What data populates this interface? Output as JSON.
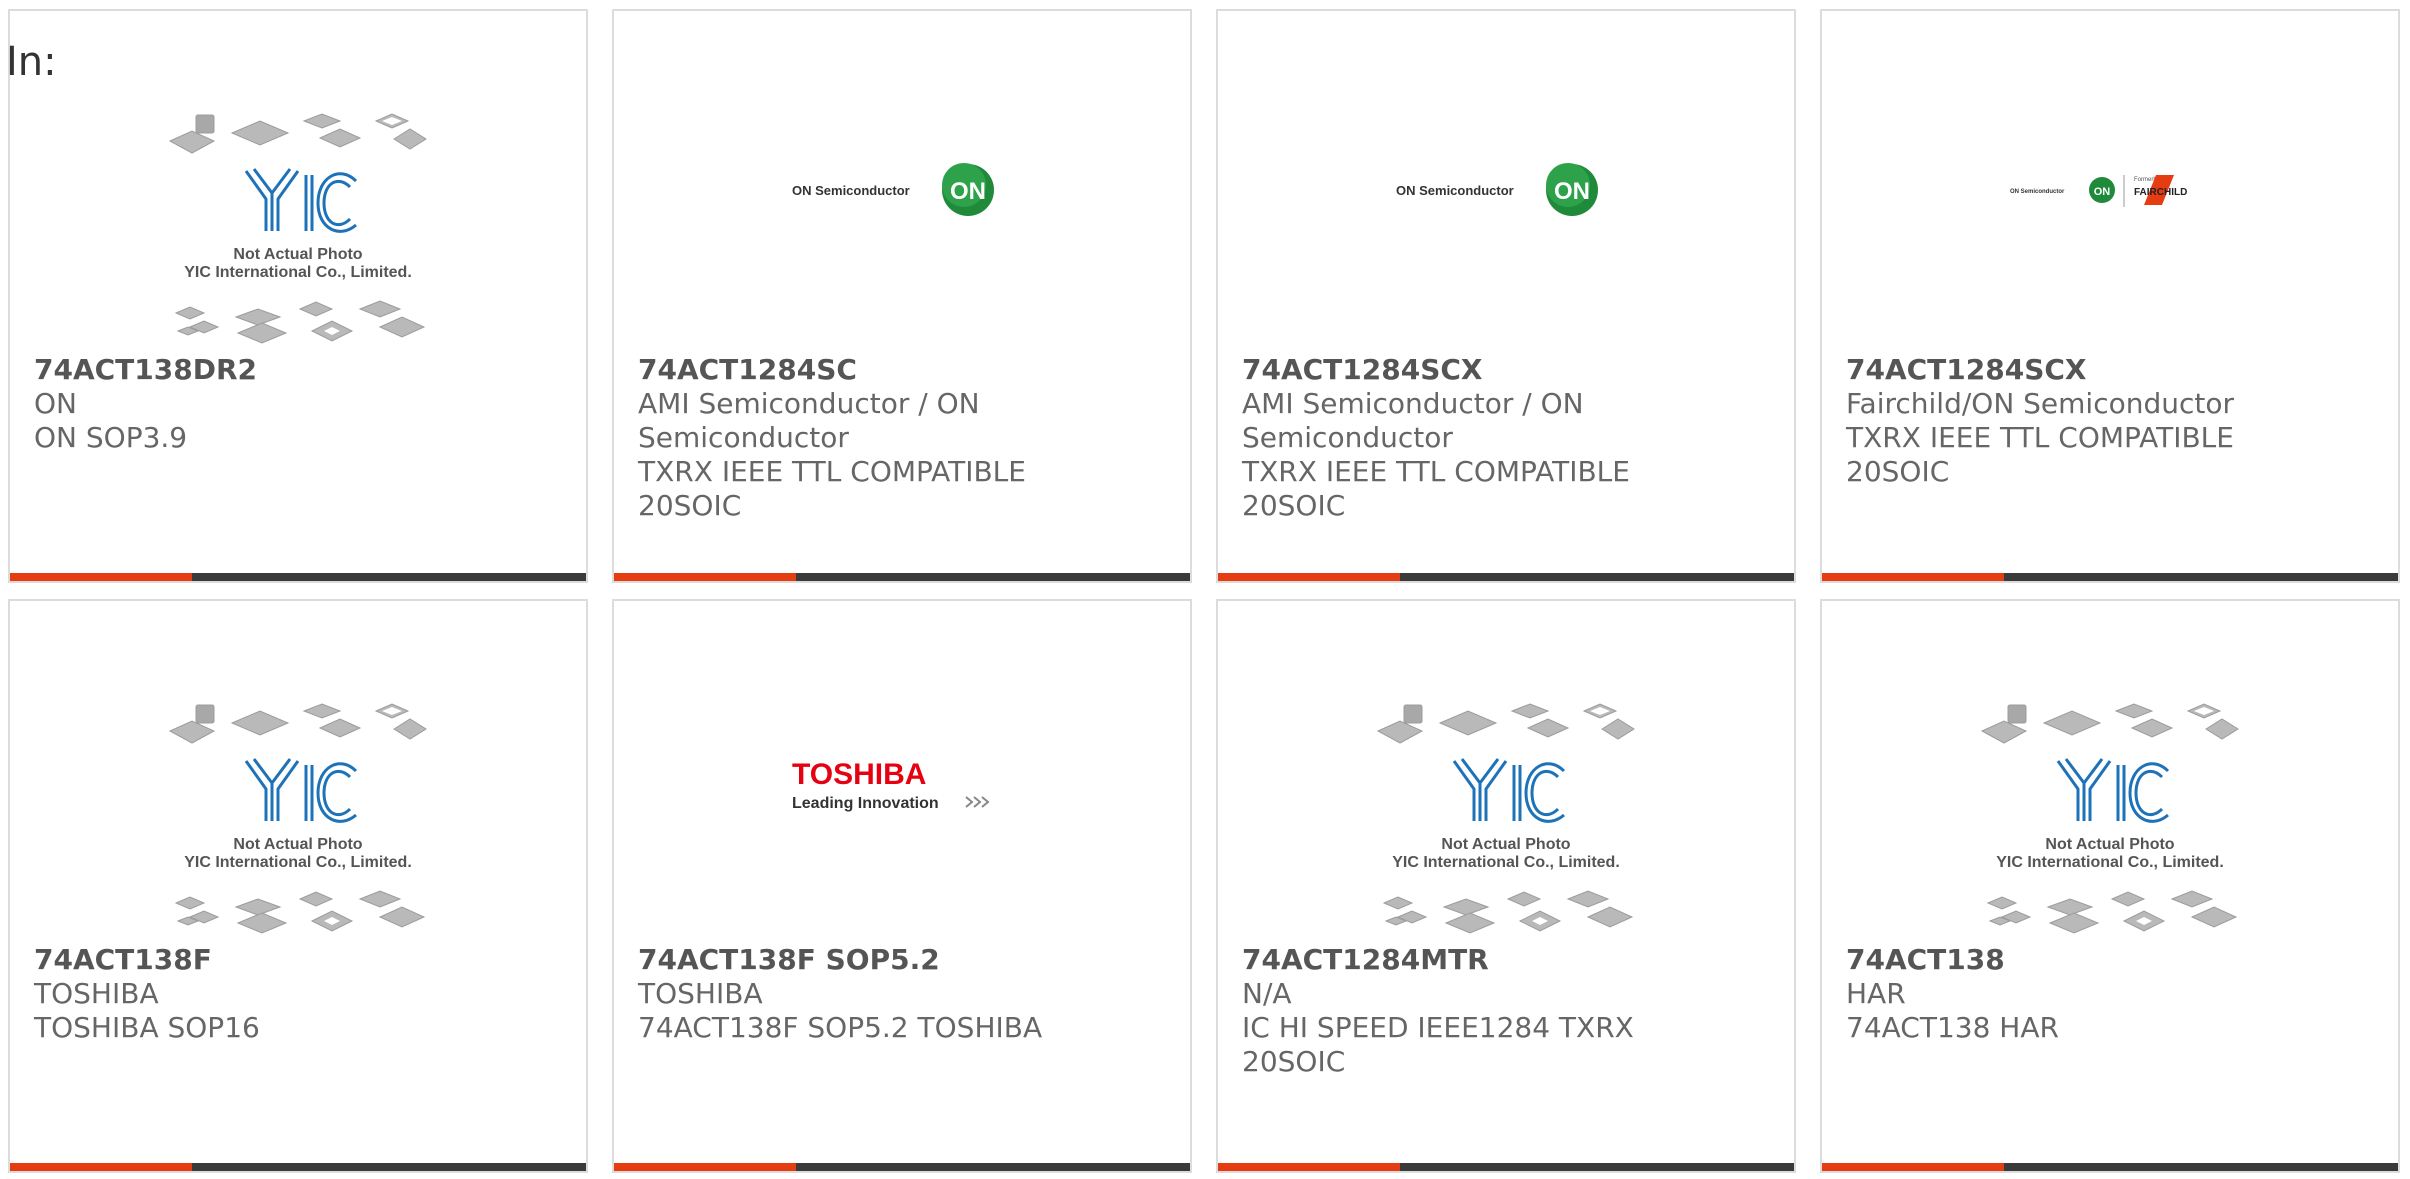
{
  "header": {
    "in_label": "In:"
  },
  "placeholder": {
    "line1": "Not Actual Photo",
    "line2": "YIC International Co., Limited."
  },
  "logos": {
    "on_text": "ON Semiconductor",
    "on_badge": "ON",
    "fairchild_formerly": "Formerly",
    "fairchild_name": "FAIRCHILD",
    "toshiba_name": "TOSHIBA",
    "toshiba_tagline": "Leading Innovation"
  },
  "colors": {
    "accent": "#e63c12",
    "bar_dark": "#3a3a3a",
    "on_green": "#1f8a3a",
    "toshiba_red": "#e60012",
    "yic_blue": "#1d72b8"
  },
  "products": [
    {
      "part": "74ACT138DR2",
      "lines": [
        "ON",
        "ON SOP3.9"
      ],
      "image": "yic-placeholder"
    },
    {
      "part": "74ACT1284SC",
      "lines": [
        "AMI Semiconductor / ON",
        "Semiconductor",
        "TXRX IEEE TTL COMPATIBLE",
        "20SOIC"
      ],
      "image": "on-semi-logo"
    },
    {
      "part": "74ACT1284SCX",
      "lines": [
        "AMI Semiconductor / ON",
        "Semiconductor",
        "TXRX IEEE TTL COMPATIBLE",
        "20SOIC"
      ],
      "image": "on-semi-logo"
    },
    {
      "part": "74ACT1284SCX",
      "lines": [
        "Fairchild/ON Semiconductor",
        "TXRX IEEE TTL COMPATIBLE",
        "20SOIC"
      ],
      "image": "fairchild-on-logo"
    },
    {
      "part": "74ACT138F",
      "lines": [
        "TOSHIBA",
        "TOSHIBA SOP16"
      ],
      "image": "yic-placeholder"
    },
    {
      "part": "74ACT138F SOP5.2",
      "lines": [
        "TOSHIBA",
        "74ACT138F SOP5.2 TOSHIBA"
      ],
      "image": "toshiba-logo"
    },
    {
      "part": "74ACT1284MTR",
      "lines": [
        "N/A",
        "IC HI SPEED IEEE1284 TXRX",
        "20SOIC"
      ],
      "image": "yic-placeholder"
    },
    {
      "part": "74ACT138",
      "lines": [
        "HAR",
        "74ACT138 HAR"
      ],
      "image": "yic-placeholder"
    }
  ]
}
